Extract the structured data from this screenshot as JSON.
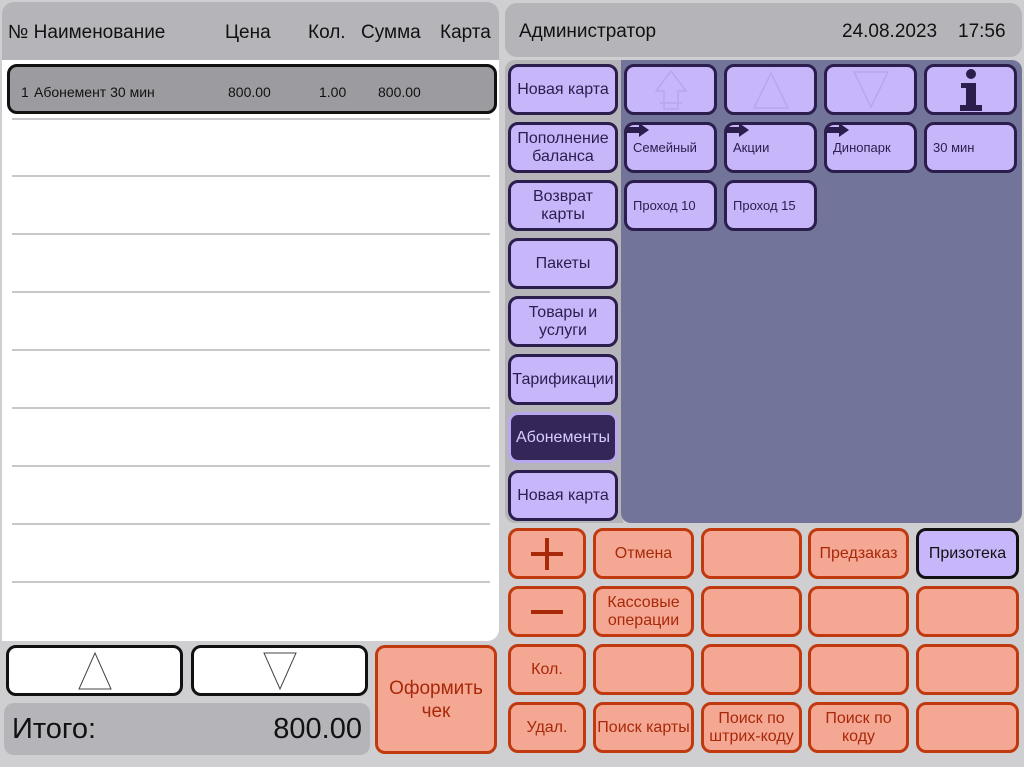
{
  "receipt": {
    "headers": {
      "no_name": "№ Наименование",
      "price": "Цена",
      "qty": "Кол.",
      "sum": "Сумма",
      "card": "Карта"
    },
    "rows": [
      {
        "no": "1",
        "name": "Абонемент 30 мин",
        "price": "800.00",
        "qty": "1.00",
        "sum": "800.00",
        "card": ""
      }
    ],
    "total_label": "Итого:",
    "total_value": "800.00",
    "checkout_label": "Оформить\nчек"
  },
  "topbar": {
    "user": "Администратор",
    "date": "24.08.2023",
    "time": "17:56"
  },
  "nav": [
    {
      "label": "Новая карта",
      "active": false
    },
    {
      "label": "Пополнение баланса",
      "active": false
    },
    {
      "label": "Возврат карты",
      "active": false
    },
    {
      "label": "Пакеты",
      "active": false
    },
    {
      "label": "Товары и услуги",
      "active": false
    },
    {
      "label": "Тарификации",
      "active": false
    },
    {
      "label": "Абонементы",
      "active": true
    },
    {
      "label": "Новая карта",
      "active": false
    }
  ],
  "tiles": [
    {
      "label": "Семейный",
      "folder": true
    },
    {
      "label": "Акции",
      "folder": true
    },
    {
      "label": "Динопарк",
      "folder": true
    },
    {
      "label": "30 мин",
      "folder": false
    },
    {
      "label": "Проход 10",
      "folder": false
    },
    {
      "label": "Проход 15",
      "folder": false
    }
  ],
  "keypad": {
    "cancel": "Отмена",
    "preorder": "Предзаказ",
    "prizes": "Призотека",
    "cash_ops": "Кассовые операции",
    "qty": "Кол.",
    "delete": "Удал.",
    "search_card": "Поиск карты",
    "search_barcode": "Поиск по штрих-коду",
    "search_code": "Поиск по коду"
  },
  "icons": {
    "up_top": "up-to-top-icon",
    "up": "up-arrow-icon",
    "down": "down-arrow-icon",
    "info": "info-icon",
    "folder": "folder-arrow-icon",
    "plus": "plus-icon",
    "minus": "minus-icon"
  },
  "colors": {
    "accent_lavender": "#c8b6fb",
    "accent_salmon": "#f4a893",
    "active_nav": "#342656",
    "content_bg": "#727599"
  }
}
